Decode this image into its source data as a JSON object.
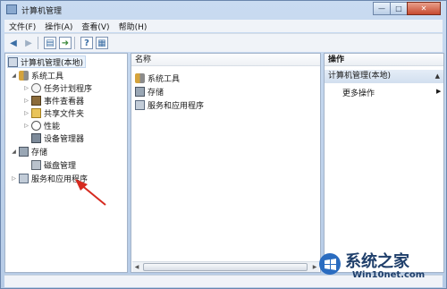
{
  "window": {
    "title": "计算机管理"
  },
  "caption_buttons": {
    "minimize": "—",
    "maximize": "□",
    "close": "✕"
  },
  "menu": [
    "文件(F)",
    "操作(A)",
    "查看(V)",
    "帮助(H)"
  ],
  "toolbar": {
    "icons": [
      "back-icon",
      "forward-icon",
      "show-hide-tree-icon",
      "export-icon",
      "help-icon",
      "properties-icon"
    ]
  },
  "tree": {
    "root": "计算机管理(本地)",
    "system_tools": "系统工具",
    "task_scheduler": "任务计划程序",
    "event_viewer": "事件查看器",
    "shared_folders": "共享文件夹",
    "performance": "性能",
    "device_manager": "设备管理器",
    "storage": "存储",
    "disk_management": "磁盘管理",
    "services_apps": "服务和应用程序"
  },
  "content": {
    "column_header": "名称",
    "items": [
      "系统工具",
      "存储",
      "服务和应用程序"
    ]
  },
  "actions": {
    "header": "操作",
    "section": "计算机管理(本地)",
    "more": "更多操作"
  },
  "watermark": {
    "brand": "系统之家",
    "url": "Win10net.com"
  },
  "colors": {
    "accent": "#3b6ea5",
    "annotation_arrow": "#d62a1f"
  }
}
